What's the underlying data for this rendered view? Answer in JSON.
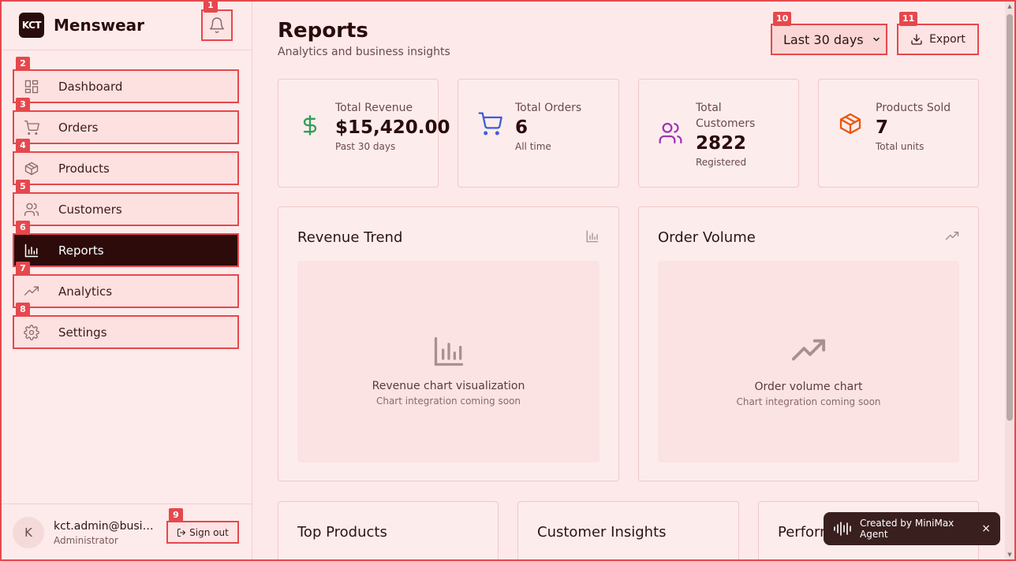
{
  "brand": {
    "logo_text": "KCT",
    "name": "Menswear"
  },
  "sidebar": {
    "items": [
      {
        "label": "Dashboard",
        "icon": "dashboard-icon",
        "active": false
      },
      {
        "label": "Orders",
        "icon": "cart-icon",
        "active": false
      },
      {
        "label": "Products",
        "icon": "box-icon",
        "active": false
      },
      {
        "label": "Customers",
        "icon": "users-icon",
        "active": false
      },
      {
        "label": "Reports",
        "icon": "bar-chart-icon",
        "active": true
      },
      {
        "label": "Analytics",
        "icon": "trending-up-icon",
        "active": false
      },
      {
        "label": "Settings",
        "icon": "gear-icon",
        "active": false
      }
    ]
  },
  "user": {
    "initial": "K",
    "email": "kct.admin@business.com",
    "role": "Administrator",
    "signout_label": "Sign out"
  },
  "header": {
    "title": "Reports",
    "subtitle": "Analytics and business insights",
    "range_selected": "Last 30 days",
    "export_label": "Export"
  },
  "stats": [
    {
      "label": "Total Revenue",
      "value": "$15,420.00",
      "note": "Past 30 days",
      "icon": "dollar-icon",
      "color": "#2e9e5b"
    },
    {
      "label": "Total Orders",
      "value": "6",
      "note": "All time",
      "icon": "cart-icon",
      "color": "#3b5bdb"
    },
    {
      "label": "Total Customers",
      "value": "2822",
      "note": "Registered",
      "icon": "users-icon",
      "color": "#9c36b5"
    },
    {
      "label": "Products Sold",
      "value": "7",
      "note": "Total units",
      "icon": "box-icon",
      "color": "#e8590c"
    }
  ],
  "charts": [
    {
      "title": "Revenue Trend",
      "placeholder": "Revenue chart visualization",
      "note": "Chart integration coming soon"
    },
    {
      "title": "Order Volume",
      "placeholder": "Order volume chart",
      "note": "Chart integration coming soon"
    }
  ],
  "bottom_cards": [
    {
      "title": "Top Products"
    },
    {
      "title": "Customer Insights"
    },
    {
      "title": "Performance"
    }
  ],
  "toast": {
    "text": "Created by MiniMax Agent"
  },
  "badges": [
    "1",
    "2",
    "3",
    "4",
    "5",
    "6",
    "7",
    "8",
    "9",
    "10",
    "11"
  ]
}
